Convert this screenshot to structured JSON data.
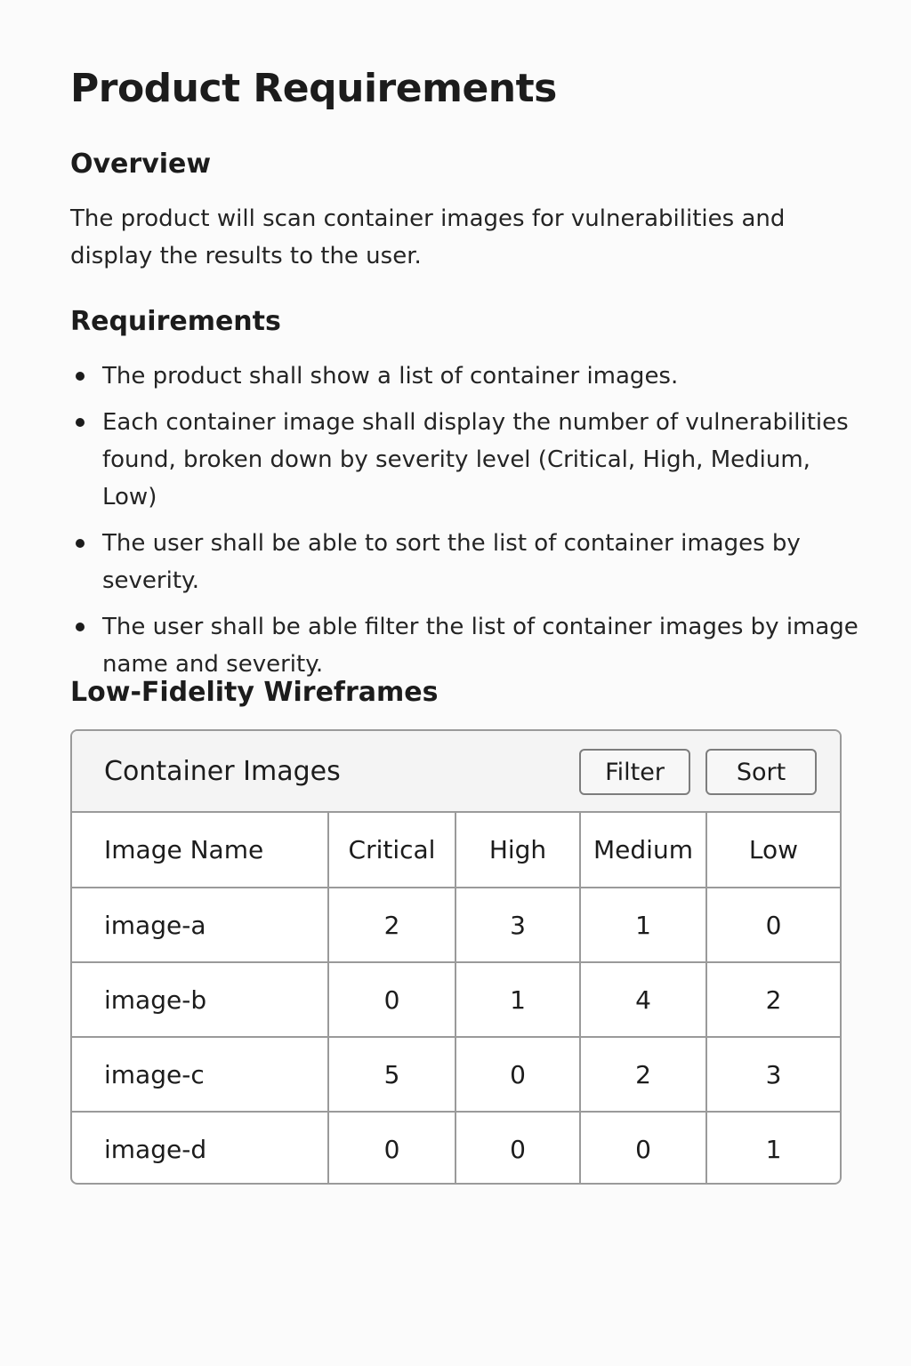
{
  "document": {
    "title": "Product Requirements",
    "overview": {
      "heading": "Overview",
      "text": "The product will scan container images for vulnerabilities and display the results to the user."
    },
    "requirements": {
      "heading": "Requirements",
      "items": [
        "The product shall show a list of container images.",
        "Each container image shall display the number of vulnerabilities found, broken down by severity level (Critical, High, Medium, Low)",
        "The user shall be able to sort the list of container images by severity.",
        "The user shall be able filter the list of container images by image name and severity."
      ]
    },
    "wireframes": {
      "heading": "Low-Fidelity Wireframes"
    }
  },
  "wireframe": {
    "panel_title": "Container Images",
    "filter_label": "Filter",
    "sort_label": "Sort",
    "columns": [
      "Image Name",
      "Critical",
      "High",
      "Medium",
      "Low"
    ],
    "rows": [
      [
        "image-a",
        "2",
        "3",
        "1",
        "0"
      ],
      [
        "image-b",
        "0",
        "1",
        "4",
        "2"
      ],
      [
        "image-c",
        "5",
        "0",
        "2",
        "3"
      ],
      [
        "image-d",
        "0",
        "0",
        "0",
        "1"
      ]
    ]
  }
}
